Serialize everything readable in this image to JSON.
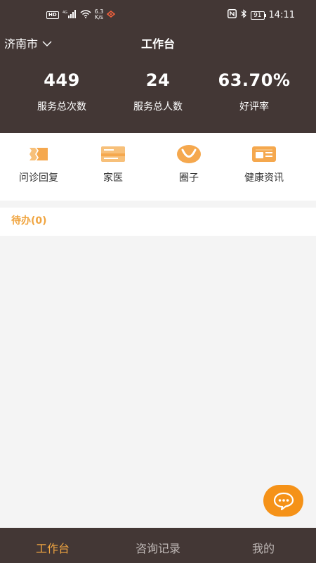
{
  "statusbar": {
    "hd": "HD",
    "network": "4G",
    "speed_value": "6.3",
    "speed_unit": "K/s",
    "battery": "91",
    "time": "14:11"
  },
  "header": {
    "city": "济南市",
    "title": "工作台"
  },
  "stats": [
    {
      "value": "449",
      "label": "服务总次数"
    },
    {
      "value": "24",
      "label": "服务总人数"
    },
    {
      "value": "63.70%",
      "label": "好评率"
    }
  ],
  "quick_actions": [
    {
      "label": "问诊回复",
      "icon": "ticket-icon"
    },
    {
      "label": "家医",
      "icon": "card-icon"
    },
    {
      "label": "圈子",
      "icon": "smile-icon"
    },
    {
      "label": "健康资讯",
      "icon": "id-card-icon"
    }
  ],
  "todo": {
    "title": "待办(0)"
  },
  "tabbar": {
    "items": [
      {
        "label": "工作台",
        "active": true
      },
      {
        "label": "咨询记录",
        "active": false
      },
      {
        "label": "我的",
        "active": false
      }
    ]
  },
  "colors": {
    "header_bg": "#433735",
    "accent": "#f0a541",
    "fab": "#f59218"
  }
}
